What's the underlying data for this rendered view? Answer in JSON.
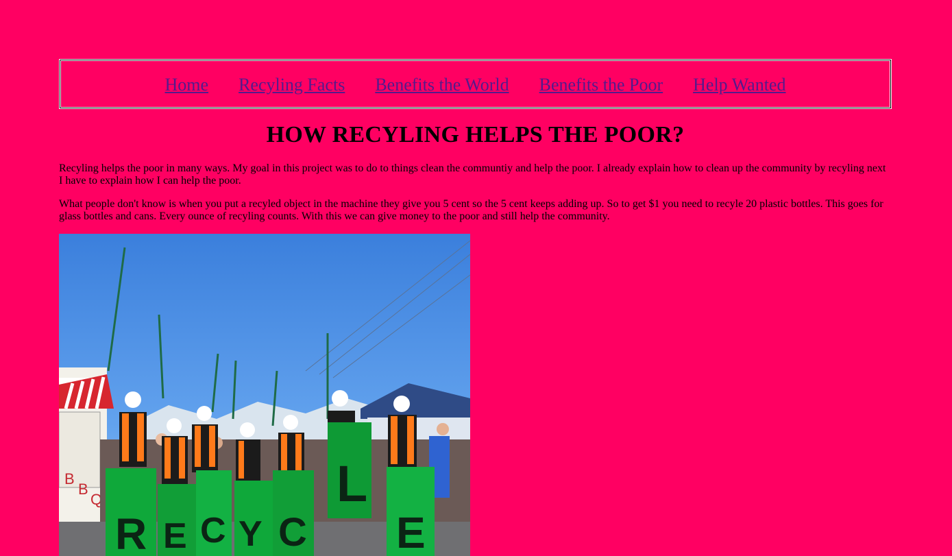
{
  "nav": {
    "items": [
      {
        "label": "Home"
      },
      {
        "label": "Recyling Facts"
      },
      {
        "label": "Benefits the World"
      },
      {
        "label": "Benefits the Poor"
      },
      {
        "label": "Help Wanted"
      }
    ]
  },
  "main": {
    "title": "HOW RECYLING HELPS THE POOR?",
    "paragraphs": [
      "Recyling helps the poor in many ways. My goal in this project was to do to things clean the communtiy and help the poor. I already explain how to clean up the community by recyling next I have to explain how I can help the poor.",
      "What people don't know is when you put a recyled object in the machine they give you 5 cent so the 5 cent keeps adding up. So to get $1 you need to recyle 20 plastic bottles. This goes for glass bottles and cans. Every ounce of recyling counts. With this we can give money to the poor and still help the community."
    ],
    "photo": {
      "bag_letters": [
        "R",
        "E",
        "C",
        "Y",
        "C",
        "L",
        "E"
      ],
      "sign_letters": [
        "B",
        "B",
        "Q"
      ]
    }
  },
  "colors": {
    "background": "#ff0062",
    "link": "#551a8b",
    "sky": "#4a8fe0",
    "bag_green": "#0fa83a"
  }
}
